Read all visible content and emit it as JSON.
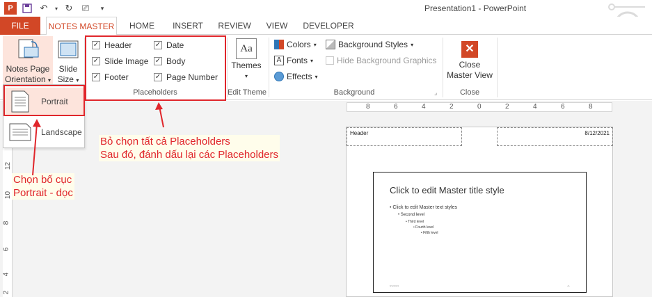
{
  "window": {
    "title": "Presentation1 - PowerPoint"
  },
  "tabs": {
    "file": "FILE",
    "notes_master": "NOTES MASTER",
    "home": "HOME",
    "insert": "INSERT",
    "review": "REVIEW",
    "view": "VIEW",
    "developer": "DEVELOPER"
  },
  "ribbon": {
    "notes_page_orientation": {
      "line1": "Notes Page",
      "line2": "Orientation"
    },
    "slide_size": {
      "line1": "Slide",
      "line2": "Size"
    },
    "placeholders": {
      "group_label": "Placeholders",
      "items": [
        {
          "label": "Header",
          "checked": true
        },
        {
          "label": "Slide Image",
          "checked": true
        },
        {
          "label": "Footer",
          "checked": true
        },
        {
          "label": "Date",
          "checked": true
        },
        {
          "label": "Body",
          "checked": true
        },
        {
          "label": "Page Number",
          "checked": true
        }
      ]
    },
    "edit_theme": {
      "themes": "Themes",
      "group_label": "Edit Theme"
    },
    "background": {
      "colors": "Colors",
      "fonts": "Fonts",
      "effects": "Effects",
      "background_styles": "Background Styles",
      "hide_background_graphics": "Hide Background Graphics",
      "group_label": "Background"
    },
    "close": {
      "line1": "Close",
      "line2": "Master View",
      "group_label": "Close"
    }
  },
  "orientation_menu": {
    "portrait": "Portrait",
    "landscape": "Landscape"
  },
  "annotations": {
    "placeholders_note_1": "Bỏ chọn tất cả Placeholders",
    "placeholders_note_2": "Sau đó, đánh dấu lại các Placeholders",
    "portrait_note_1": "Chọn bố cục",
    "portrait_note_2": "Portrait - dọc"
  },
  "notes_page": {
    "header": "Header",
    "date": "8/12/2021",
    "slide_title": "Click to edit Master title style",
    "levels": [
      "• Click to edit Master text styles",
      "• Second level",
      "• Third level",
      "• Fourth level",
      "• Fifth level"
    ],
    "footer_date": "8/12/2021",
    "footer_num": "‹#›"
  },
  "hruler_labels": [
    "8",
    "6",
    "4",
    "2",
    "0",
    "2",
    "4",
    "6",
    "8"
  ],
  "vruler_labels": [
    "12",
    "10",
    "8",
    "6",
    "4",
    "2"
  ],
  "colors": {
    "accent": "#d24726",
    "annotation": "#e0262b"
  }
}
